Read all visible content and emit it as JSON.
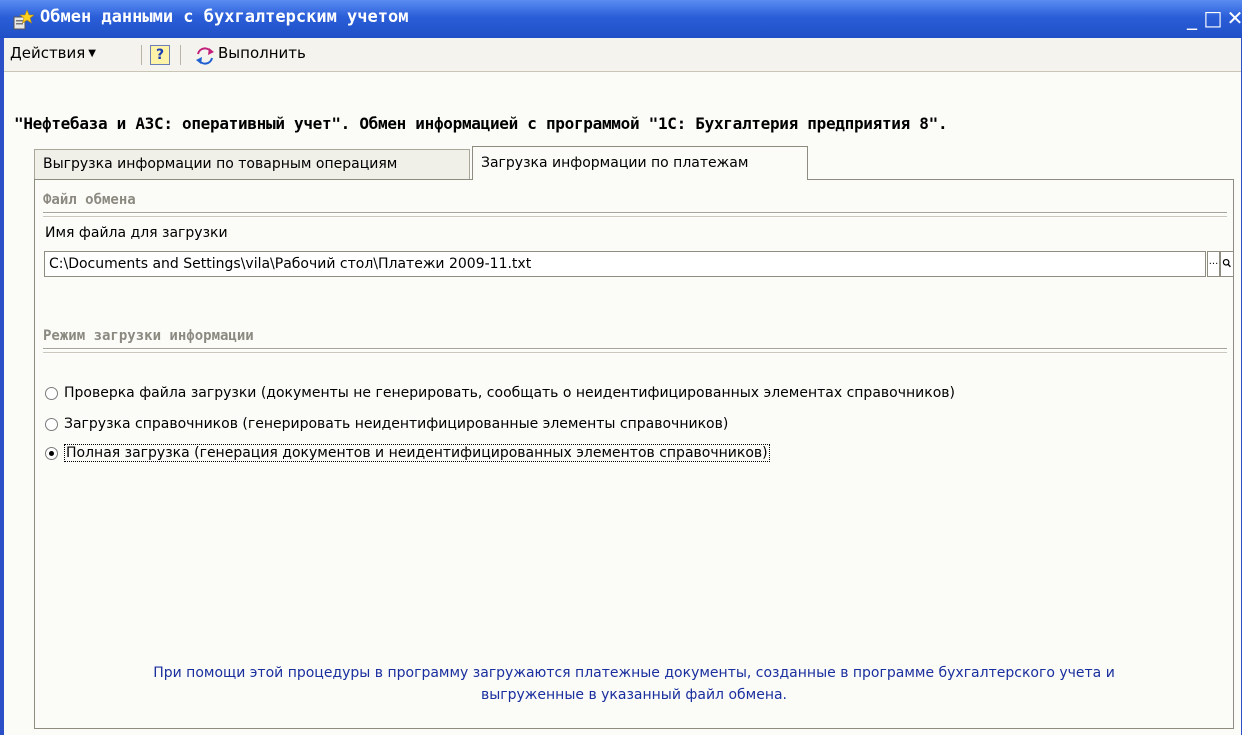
{
  "window": {
    "title": "Обмен данными с бухгалтерским учетом",
    "controls": {
      "minimize": "_",
      "maximize": "□",
      "close": "✕"
    }
  },
  "toolbar": {
    "actions_label": "Действия",
    "help_label": "?",
    "run_label": "Выполнить"
  },
  "heading": "\"Нефтебаза и АЗС: оперативный учет\". Обмен информацией с программой \"1С: Бухгалтерия предприятия 8\".",
  "tabs": [
    {
      "label": "Выгрузка информации по товарным операциям",
      "active": false
    },
    {
      "label": "Загрузка информации по платежам",
      "active": true
    }
  ],
  "exchange_file": {
    "section_title": "Файл обмена",
    "field_label": "Имя файла для загрузки",
    "value": "C:\\Documents and Settings\\vila\\Рабочий стол\\Платежи 2009-11.txt",
    "choose_button": "..."
  },
  "load_mode": {
    "section_title": "Режим загрузки информации",
    "options": [
      {
        "label": "Проверка файла загрузки (документы не генерировать, сообщать о неидентифицированных элементах справочников)",
        "checked": false
      },
      {
        "label": "Загрузка справочников (генерировать неидентифицированные элементы справочников)",
        "checked": false
      },
      {
        "label": "Полная загрузка (генерация документов и неидентифицированных элементов справочников)",
        "checked": true
      }
    ]
  },
  "note": {
    "line1": "При помощи этой процедуры в программу загружаются платежные документы, созданные в программе бухгалтерского учета и",
    "line2": "выгруженные в указанный файл обмена."
  },
  "icons": {
    "title": "form-window-icon",
    "help": "help-icon",
    "run": "run-exchange-icon",
    "open": "magnifier-icon"
  },
  "colors": {
    "title_bar": "#2a5ed8",
    "note_text": "#1a2f9e",
    "section_title": "#8c8a80"
  }
}
